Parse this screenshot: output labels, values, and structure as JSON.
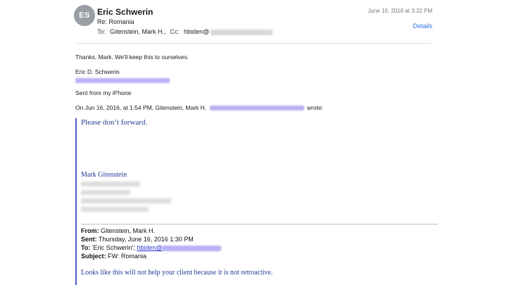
{
  "header": {
    "avatar_initials": "ES",
    "sender": "Eric Schwerin",
    "subject": "Re: Romania",
    "to_label": "To:",
    "to_value": "Gitenstein, Mark H.,",
    "cc_label": "Cc:",
    "cc_value": "hbiden@",
    "date": "June 16, 2016 at 3:32 PM",
    "details_label": "Details"
  },
  "reply": {
    "line1": "Thanks, Mark.   We'll keep this to ourselves.",
    "sig_name": "Eric D. Schwerin",
    "sent_from": "Sent from my iPhone",
    "on_wrote_prefix": "On Jun 16, 2016, at 1:54 PM, Gitenstein, Mark H.",
    "on_wrote_suffix": "wrote:"
  },
  "quoted": {
    "line1": "Please don’t forward.",
    "sig_name": "Mark Gitenstein",
    "from_label": "From:",
    "from_value": "Gitenstein, Mark H.",
    "sent_label": "Sent:",
    "sent_value": "Thursday, June 16, 2016 1:30 PM",
    "to_label": "To:",
    "to_value": "'Eric Schwerin';",
    "to_link": "hbiden@",
    "subject_label": "Subject:",
    "subject_value": "FW: Romania",
    "body": "Looks like this will not help your client because it is not retroactive."
  },
  "colors": {
    "link": "#2b74d9",
    "quote_text": "#1f3a93",
    "quote_bar": "#4c5bd1"
  }
}
